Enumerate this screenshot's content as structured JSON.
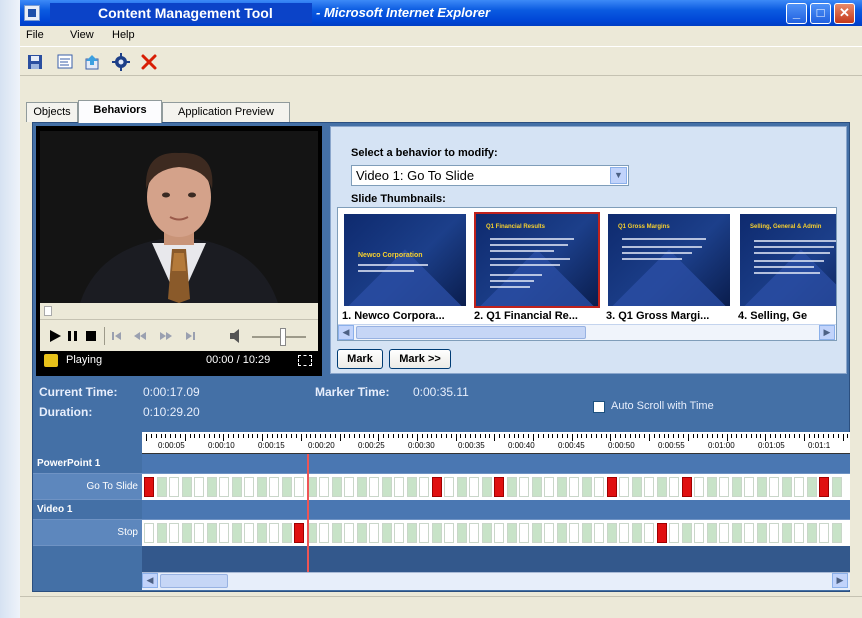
{
  "window": {
    "app_title": "Content Management Tool",
    "browser_title": "- Microsoft Internet Explorer",
    "min_label": "_",
    "max_label": "□",
    "close_label": "✕"
  },
  "menu": {
    "items": [
      "File",
      "View",
      "Help"
    ]
  },
  "toolbar": {
    "icons": [
      "save-icon",
      "properties-icon",
      "publish-icon",
      "settings-icon",
      "delete-icon"
    ],
    "delete_color": "#d81e05"
  },
  "tabs": [
    {
      "label": "Objects",
      "active": false
    },
    {
      "label": "Behaviors",
      "active": true
    },
    {
      "label": "Application Preview",
      "active": false
    }
  ],
  "player": {
    "status": "Playing",
    "time": "00:00 / 10:29"
  },
  "behavior": {
    "prompt": "Select a behavior to modify:",
    "selected": "Video 1: Go To Slide",
    "thumbs_label": "Slide Thumbnails:",
    "thumbnails": [
      {
        "caption": "1. Newco Corpora...",
        "title": "Newco Corporation",
        "selected": false
      },
      {
        "caption": "2. Q1 Financial Re...",
        "title": "Q1 Financial Results",
        "selected": true
      },
      {
        "caption": "3. Q1 Gross Margi...",
        "title": "Q1 Gross Margins",
        "selected": false
      },
      {
        "caption": "4. Selling, Ge",
        "title": "Selling, General & Admin",
        "selected": false
      }
    ],
    "mark_label": "Mark",
    "mark_next_label": "Mark >>"
  },
  "timeline": {
    "current_time_label": "Current Time:",
    "current_time": "0:00:17.09",
    "duration_label": "Duration:",
    "duration": "0:10:29.20",
    "marker_time_label": "Marker Time:",
    "marker_time": "0:00:35.11",
    "autoscroll_label": "Auto Scroll with Time",
    "ruler": [
      "0:00:05",
      "0:00:10",
      "0:00:15",
      "0:00:20",
      "0:00:25",
      "0:00:30",
      "0:00:35",
      "0:00:40",
      "0:00:45",
      "0:00:50",
      "0:00:55",
      "0:01:00",
      "0:01:05",
      "0:01:1"
    ],
    "rows": [
      {
        "group": "PowerPoint 1",
        "track": "Go To Slide",
        "markers": [
          0,
          23,
          28,
          37,
          43,
          54
        ]
      },
      {
        "group": "Video 1",
        "track": "Stop",
        "markers": [
          12,
          41
        ]
      }
    ]
  },
  "colors": {
    "marker": "#e01010",
    "segment_a": "#ffffff",
    "segment_b": "#c8e3c8",
    "cursor": "#ee5555"
  }
}
